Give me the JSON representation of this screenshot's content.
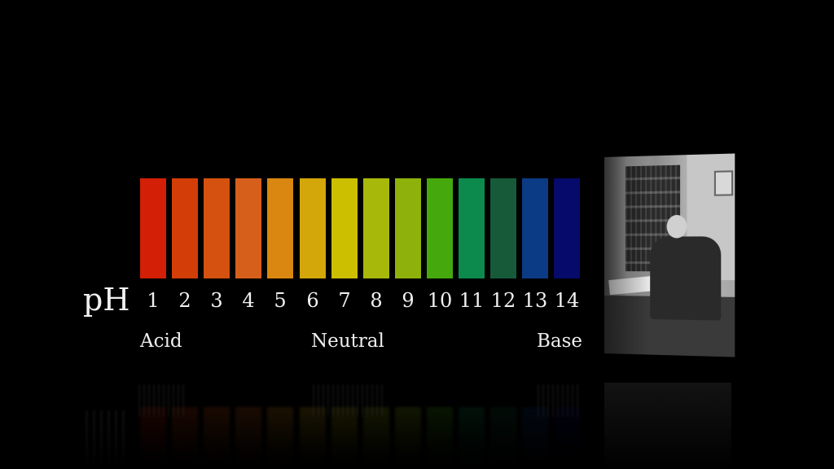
{
  "scale": {
    "prefix": "pH",
    "levels": [
      {
        "value": "1",
        "color": "#d21f05"
      },
      {
        "value": "2",
        "color": "#d33d07"
      },
      {
        "value": "3",
        "color": "#d4510f"
      },
      {
        "value": "4",
        "color": "#d65f1c"
      },
      {
        "value": "5",
        "color": "#d98710"
      },
      {
        "value": "6",
        "color": "#d3a60a"
      },
      {
        "value": "7",
        "color": "#cbbf00"
      },
      {
        "value": "8",
        "color": "#a8b80a"
      },
      {
        "value": "9",
        "color": "#8fb10b"
      },
      {
        "value": "10",
        "color": "#45a80c"
      },
      {
        "value": "11",
        "color": "#0c8a4e"
      },
      {
        "value": "12",
        "color": "#175a3a"
      },
      {
        "value": "13",
        "color": "#0c3b86"
      },
      {
        "value": "14",
        "color": "#060a6a"
      }
    ],
    "zones": {
      "acid": "Acid",
      "neutral": "Neutral",
      "base": "Base"
    }
  },
  "photo": {
    "icon": "scientist-portrait-photo"
  }
}
